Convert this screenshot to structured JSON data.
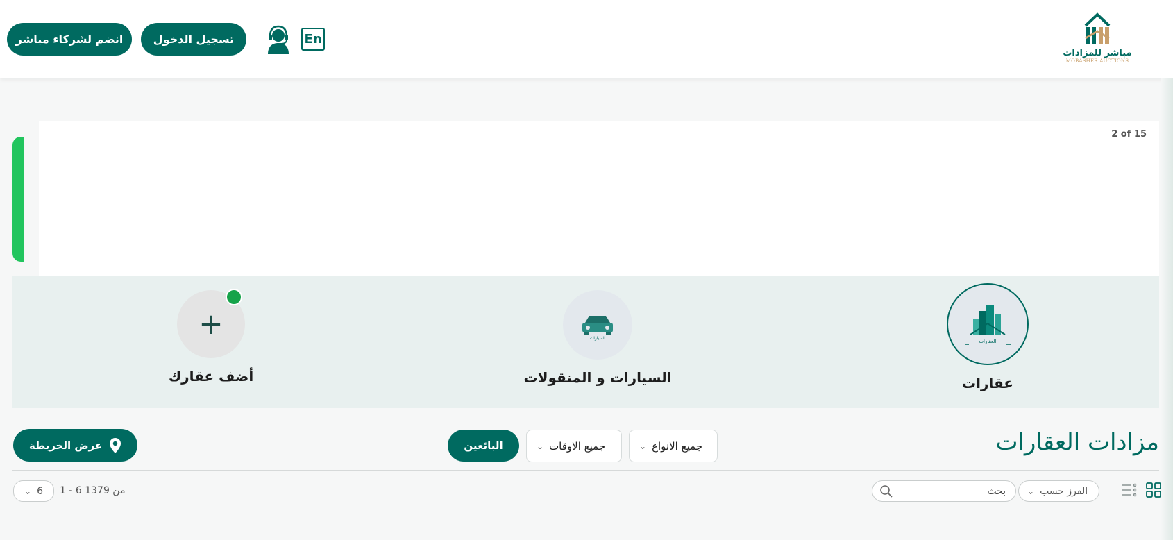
{
  "header": {
    "join_partners_label": "انضم لشركاء مباشر",
    "login_label": "تسجيل الدخول",
    "language_label": "En",
    "logo_text_ar": "مباشر للمزادات",
    "logo_text_en": "MOBASHER AUCTIONS"
  },
  "slider": {
    "counter": "2 of 15"
  },
  "categories": [
    {
      "label": "عقارات",
      "icon": "buildings-icon",
      "active": true
    },
    {
      "label": "السيارات و المنقولات",
      "icon": "car-icon",
      "active": false
    },
    {
      "label": "أضف عقارك",
      "icon": "plus-icon",
      "active": false
    }
  ],
  "category_icon_caption_realestate": "العقارات",
  "category_icon_caption_cars": "السيارات",
  "toolbar": {
    "title": "مزادات العقارات",
    "types_filter": "جميع الانواع",
    "times_filter": "جميع الاوقات",
    "sellers_label": "البائعين",
    "map_label": "عرض الخريطة"
  },
  "list_controls": {
    "sort_label": "الفرز حسب",
    "search_placeholder": "بحث",
    "range_text": "1 - 6 من 1379",
    "per_page": "6"
  },
  "colors": {
    "primary": "#006a60",
    "accent_green": "#22c55e",
    "logo_gold": "#c89f6b"
  }
}
